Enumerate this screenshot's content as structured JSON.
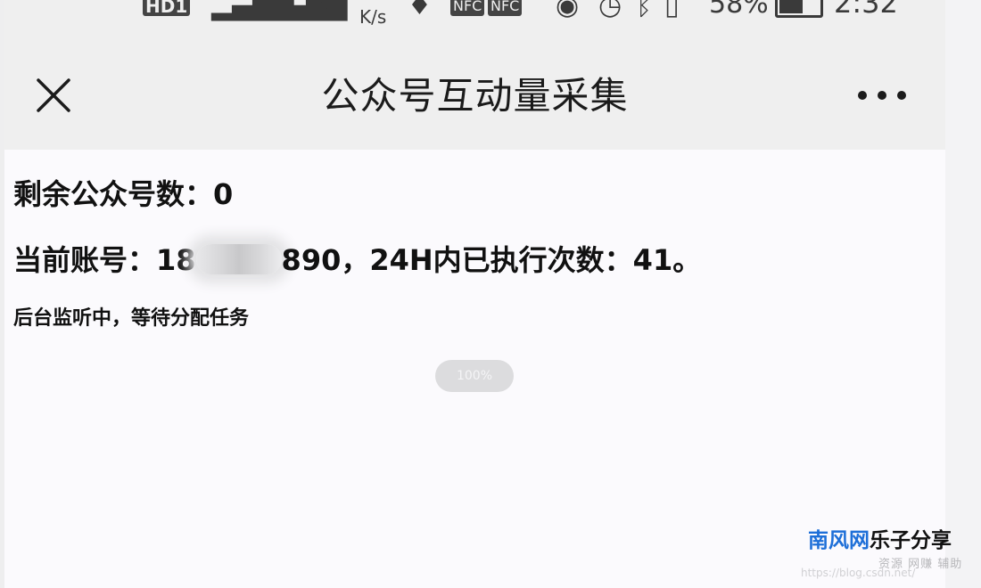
{
  "status_bar": {
    "network_badge": "HD1",
    "net_speed_unit": "K/s",
    "nfc_badge_1": "NFC",
    "nfc_badge_2": "NFC",
    "battery_percent": "58%",
    "battery_level": 0.58,
    "time": "2:32"
  },
  "title_bar": {
    "title": "公众号互动量采集"
  },
  "content": {
    "remaining_label": "剩余公众号数：",
    "remaining_value": "0",
    "account_label": "当前账号：",
    "account_prefix": "18",
    "account_suffix": "890",
    "executed_text": "，24H内已执行次数：",
    "executed_value": "41",
    "executed_end": "。",
    "status_text": "后台监听中，等待分配任务",
    "progress_text": "100%"
  },
  "watermark": {
    "brand_blue": "南风网",
    "brand_black": "乐子分享",
    "subtitle": "资源 网赚 辅助",
    "url": "https://blog.csdn.net/"
  },
  "colors": {
    "background": "#fbfafd",
    "title_bar_bg": "#efefef",
    "brand_blue": "#1e6fd8"
  }
}
